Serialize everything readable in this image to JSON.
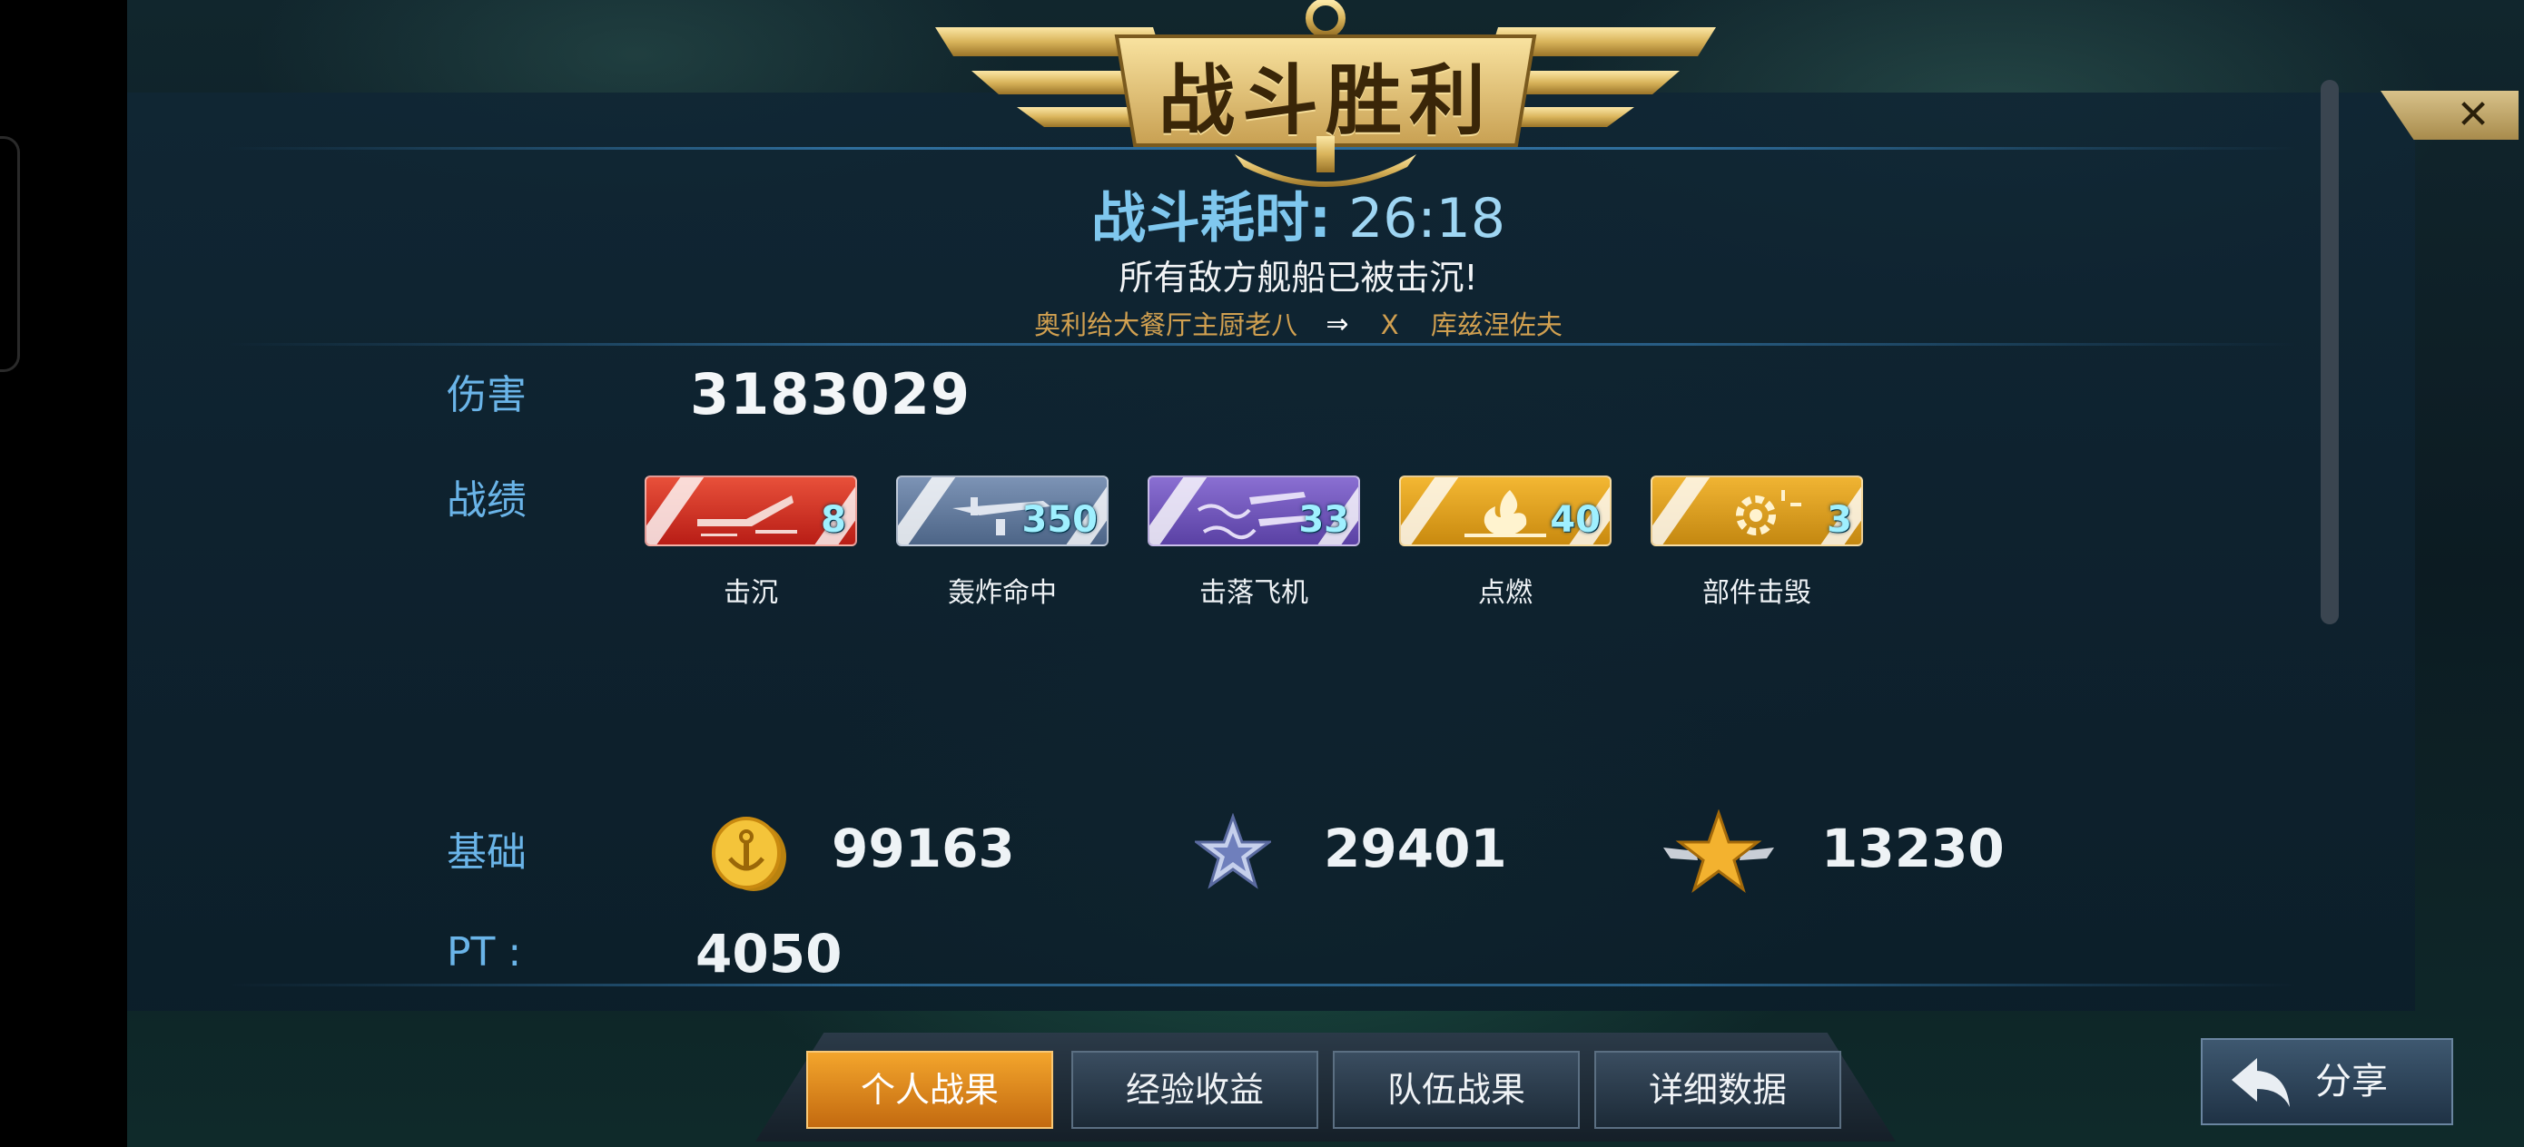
{
  "header": {
    "title": "战斗胜利",
    "close_label": "✕",
    "battle_time_label": "战斗耗时:",
    "battle_time_value": "26:18",
    "result_message": "所有敌方舰船已被击沉!",
    "player_name": "奥利给大餐厅主厨老八",
    "vs_text": "X",
    "ship_name": "库兹涅佐夫"
  },
  "damage": {
    "label": "伤害",
    "value": "3183029"
  },
  "record": {
    "label": "战绩",
    "badges": [
      {
        "icon": "ship-sinking-icon",
        "value": "8",
        "label": "击沉",
        "color": "#d8342a"
      },
      {
        "icon": "bomber-hit-icon",
        "value": "350",
        "label": "轰炸命中",
        "color": "#6a82a6"
      },
      {
        "icon": "plane-shot-down-icon",
        "value": "33",
        "label": "击落飞机",
        "color": "#7459bd"
      },
      {
        "icon": "fire-icon",
        "value": "40",
        "label": "点燃",
        "color": "#e2a221"
      },
      {
        "icon": "gear-burst-icon",
        "value": "3",
        "label": "部件击毁",
        "color": "#e0a021"
      }
    ]
  },
  "base": {
    "label": "基础",
    "rewards": [
      {
        "icon": "gold-coin-icon",
        "value": "99163"
      },
      {
        "icon": "silver-star-icon",
        "value": "29401"
      },
      {
        "icon": "gold-star-wings-icon",
        "value": "13230"
      }
    ]
  },
  "pt": {
    "label": "PT :",
    "value": "4050"
  },
  "tabs": [
    {
      "label": "个人战果",
      "active": true
    },
    {
      "label": "经验收益",
      "active": false
    },
    {
      "label": "队伍战果",
      "active": false
    },
    {
      "label": "详细数据",
      "active": false
    }
  ],
  "share": {
    "label": "分享",
    "icon": "share-arrow-icon"
  }
}
